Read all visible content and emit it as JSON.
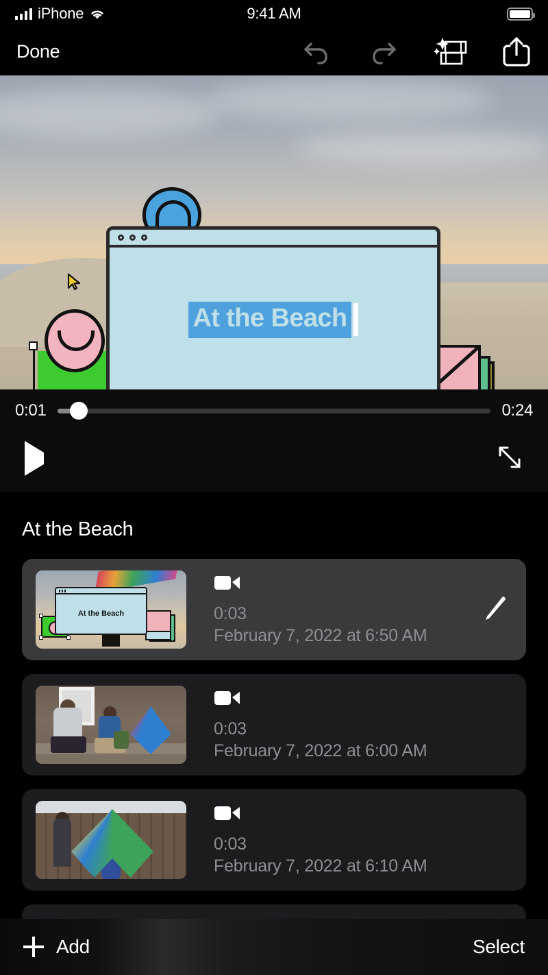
{
  "status_bar": {
    "carrier": "iPhone",
    "time": "9:41 AM",
    "signal_icon": "cellular-bars-icon",
    "wifi_icon": "wifi-icon",
    "battery_icon": "battery-full-icon"
  },
  "nav_bar": {
    "done_label": "Done",
    "icons": [
      {
        "name": "undo-icon",
        "label": "Undo"
      },
      {
        "name": "redo-icon",
        "label": "Redo"
      },
      {
        "name": "magic-movie-icon",
        "label": "Magic Movie"
      },
      {
        "name": "share-icon",
        "label": "Share"
      }
    ]
  },
  "preview": {
    "title_card_text": "At the Beach",
    "title_highlight_color": "#4ea1dd",
    "card_background_color": "#bfe0e8",
    "selected_shape_color": "#3ecb2f",
    "cursor_icon": "pointer-cursor-icon"
  },
  "player": {
    "current_time": "0:01",
    "total_time": "0:24",
    "progress_percent": 5,
    "play_icon": "play-icon",
    "expand_icon": "fullscreen-expand-icon"
  },
  "project": {
    "title": "At the Beach"
  },
  "clips": [
    {
      "selected": true,
      "media_icon": "video-camera-icon",
      "duration": "0:03",
      "date": "February 7, 2022 at 6:50 AM",
      "thumb_title": "At the Beach",
      "action_icon": "pencil-edit-icon"
    },
    {
      "selected": false,
      "media_icon": "video-camera-icon",
      "duration": "0:03",
      "date": "February 7, 2022 at 6:00 AM"
    },
    {
      "selected": false,
      "media_icon": "video-camera-icon",
      "duration": "0:03",
      "date": "February 7, 2022 at 6:10 AM"
    }
  ],
  "bottom_bar": {
    "add_label": "Add",
    "add_icon": "plus-icon",
    "select_label": "Select"
  }
}
